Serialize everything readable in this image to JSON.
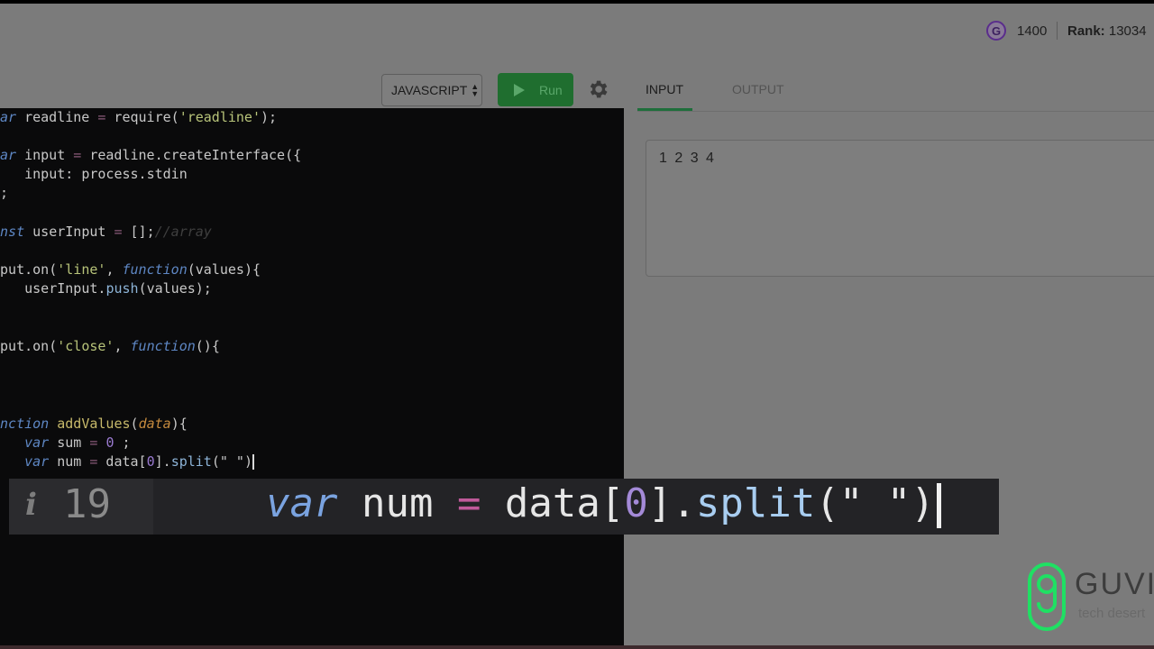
{
  "header": {
    "badge_letter": "G",
    "points": "1400",
    "rank_label": "Rank:",
    "rank_value": "13034"
  },
  "toolbar": {
    "language": "JAVASCRIPT",
    "run_label": "Run"
  },
  "tabs": {
    "input_label": "INPUT",
    "output_label": "OUTPUT"
  },
  "input_panel": {
    "value": "1 2 3 4"
  },
  "editor": {
    "l1": {
      "a": "ar",
      "b": " readline ",
      "c": "=",
      "d": " require(",
      "e": "'readline'",
      "f": ");"
    },
    "l2": {
      "a": "ar",
      "b": " input ",
      "c": "=",
      "d": " readline.createInterface({"
    },
    "l3": {
      "a": "    input: process.stdin"
    },
    "l4": {
      "a": ");"
    },
    "l5": {
      "a": "onst",
      "b": " userInput ",
      "c": "=",
      "d": " [];",
      "e": "//array"
    },
    "l6": {
      "a": "nput.on(",
      "b": "'line'",
      "c": ", ",
      "d": "function",
      "e": "(values){"
    },
    "l7": {
      "a": "    userInput.",
      "b": "push",
      "c": "(values);"
    },
    "l8": {
      "a": ")"
    },
    "l9": {
      "a": "nput.on(",
      "b": "'close'",
      "c": ", ",
      "d": "function",
      "e": "(){"
    },
    "l10": {
      "a": ")"
    },
    "l11": {
      "a": "unction",
      "b": " addValues",
      "c": "(",
      "d": "data",
      "e": "){"
    },
    "l12": {
      "a": "    ",
      "b": "var",
      "c": " sum ",
      "d": "=",
      "e": " ",
      "f": "0",
      "g": " ;"
    },
    "l13": {
      "a": "    ",
      "b": "var",
      "c": " num ",
      "d": "=",
      "e": " data[",
      "f": "0",
      "g": "].",
      "h": "split",
      "i": "(\" \")"
    }
  },
  "zoom": {
    "info_glyph": "i",
    "line_number": "19",
    "kw": "var",
    "name": " num ",
    "op": "=",
    "pre": " data[",
    "idx": "0",
    "mid": "].",
    "method": "split",
    "args": "(\" \")"
  },
  "brand": {
    "name": "GUVI",
    "tagline": "tech desert"
  },
  "colors": {
    "run_green": "#1f6e2f",
    "tab_accent": "#1e6e3b",
    "logo_green": "#1fe063"
  }
}
